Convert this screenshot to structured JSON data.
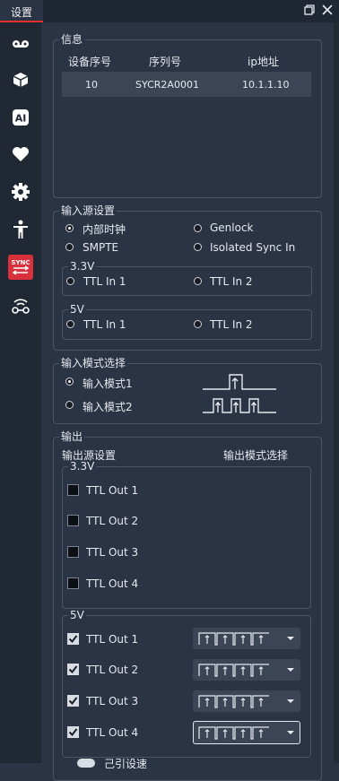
{
  "window": {
    "tab_label": "设置"
  },
  "sidebar": {
    "items": [
      "voicemail-icon",
      "cube-icon",
      "ai-icon",
      "heart-icon",
      "gear-icon",
      "person-icon",
      "sync-icon",
      "wireless-icon"
    ]
  },
  "info": {
    "title": "信息",
    "columns": [
      "设备序号",
      "序列号",
      "ip地址"
    ],
    "rows": [
      [
        "10",
        "SYCR2A0001",
        "10.1.1.10"
      ]
    ]
  },
  "input_source": {
    "title": "输入源设置",
    "options": [
      {
        "label": "内部时钟",
        "selected": true
      },
      {
        "label": "Genlock",
        "selected": false
      },
      {
        "label": "SMPTE",
        "selected": false
      },
      {
        "label": "Isolated Sync In",
        "selected": false
      }
    ],
    "group_33": {
      "title": "3.3V",
      "items": [
        "TTL In 1",
        "TTL In 2"
      ]
    },
    "group_5": {
      "title": "5V",
      "items": [
        "TTL In 1",
        "TTL In 2"
      ]
    }
  },
  "input_mode": {
    "title": "输入模式选择",
    "options": [
      {
        "label": "输入模式1",
        "selected": true
      },
      {
        "label": "输入模式2",
        "selected": false
      }
    ]
  },
  "output": {
    "title": "输出",
    "source_header": "输出源设置",
    "mode_header": "输出模式选择",
    "group_33": {
      "title": "3.3V",
      "items": [
        {
          "label": "TTL Out 1",
          "checked": false
        },
        {
          "label": "TTL Out 2",
          "checked": false
        },
        {
          "label": "TTL Out 3",
          "checked": false
        },
        {
          "label": "TTL Out 4",
          "checked": false
        }
      ]
    },
    "group_5": {
      "title": "5V",
      "items": [
        {
          "label": "TTL Out 1",
          "checked": true
        },
        {
          "label": "TTL Out 2",
          "checked": true
        },
        {
          "label": "TTL Out 3",
          "checked": true
        },
        {
          "label": "TTL Out 4",
          "checked": true
        }
      ]
    },
    "partial_label": "己引设速"
  }
}
